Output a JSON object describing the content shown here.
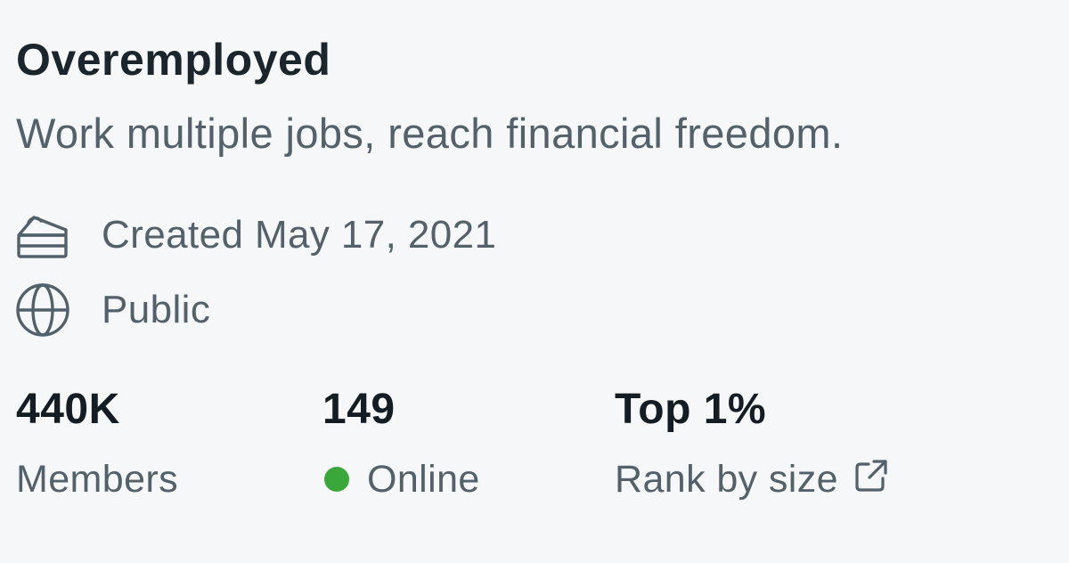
{
  "community": {
    "name": "Overemployed",
    "description": "Work multiple jobs, reach financial freedom."
  },
  "meta": {
    "created": {
      "icon": "cake-icon",
      "text": "Created May 17, 2021"
    },
    "visibility": {
      "icon": "globe-icon",
      "text": "Public"
    }
  },
  "stats": {
    "members": {
      "value": "440K",
      "label": "Members"
    },
    "online": {
      "value": "149",
      "label": "Online",
      "status_color": "#3aa73a"
    },
    "rank": {
      "value": "Top 1%",
      "label": "Rank by size",
      "icon": "external-link-icon"
    }
  },
  "colors": {
    "background": "#f6f7f8",
    "title_text": "#1a252c",
    "secondary_text": "#53616b",
    "online_dot": "#3aa73a"
  }
}
